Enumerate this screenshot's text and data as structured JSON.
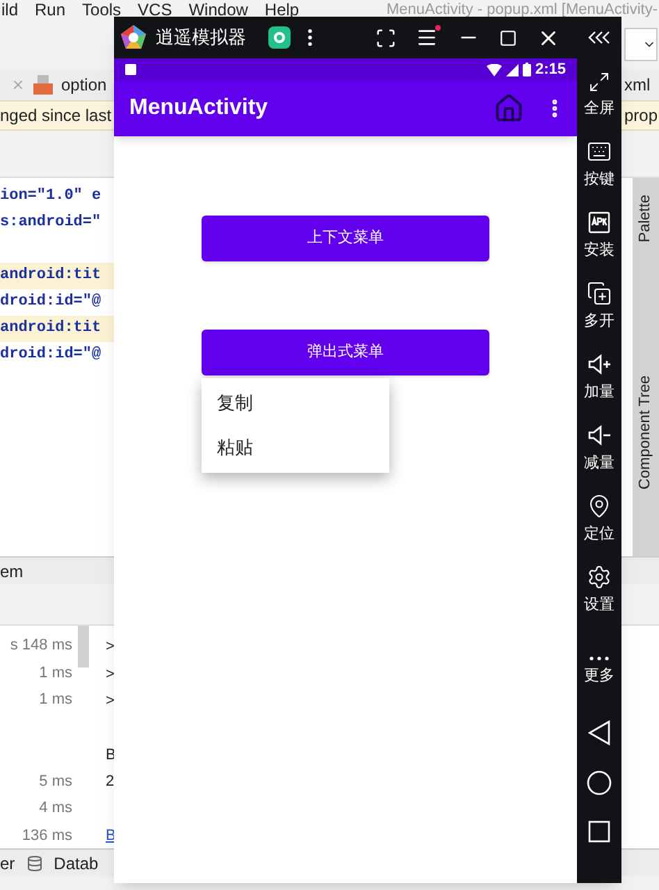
{
  "ide": {
    "menu_bar": [
      "ild",
      "Run",
      "Tools",
      "VCS",
      "Window",
      "Help"
    ],
    "window_title": "MenuActivity - popup.xml [MenuActivity-",
    "editor_tabs": [
      "option",
      "xml"
    ],
    "banner": [
      "nged since last",
      "prop"
    ],
    "code_lines": [
      {
        "text": "ion=\"1.0\" e",
        "highlighted": false
      },
      {
        "text": "s:android=\"",
        "highlighted": false
      },
      {
        "text": "android:tit",
        "highlighted": true
      },
      {
        "text": "droid:id=\"@",
        "highlighted": false
      },
      {
        "text": "android:tit",
        "highlighted": true
      },
      {
        "text": "droid:id=\"@",
        "highlighted": false
      }
    ],
    "side_tabs": [
      "Palette",
      "Component Tree"
    ],
    "panel_title": "em",
    "timing_groups": [
      [
        "s 148 ms",
        "1 ms",
        "1 ms"
      ],
      [
        "5 ms",
        "4 ms",
        "136 ms"
      ]
    ],
    "console_groups": [
      [
        {
          "text": ">",
          "kind": "plain"
        },
        {
          "text": ">",
          "kind": "plain"
        },
        {
          "text": ">",
          "kind": "plain"
        }
      ],
      [
        {
          "text": "B",
          "kind": "plain"
        },
        {
          "text": "2",
          "kind": "plain"
        }
      ],
      [
        {
          "text": "B",
          "kind": "link"
        }
      ]
    ],
    "status_bar": [
      "er",
      "Datab"
    ]
  },
  "emulator": {
    "title": "逍遥模拟器",
    "tools": [
      {
        "label": "全屏",
        "kind": "fullscreen"
      },
      {
        "label": "按键",
        "kind": "keyboard"
      },
      {
        "label": "安装",
        "kind": "apk"
      },
      {
        "label": "多开",
        "kind": "multi"
      },
      {
        "label": "加量",
        "kind": "volume_up"
      },
      {
        "label": "减量",
        "kind": "volume_down"
      },
      {
        "label": "定位",
        "kind": "location"
      },
      {
        "label": "设置",
        "kind": "settings"
      },
      {
        "label": "更多",
        "kind": "more"
      }
    ]
  },
  "phone": {
    "time": "2:15",
    "app_title": "MenuActivity",
    "buttons": [
      "上下文菜单",
      "弹出式菜单"
    ],
    "popup_menu": [
      "复制",
      "粘贴"
    ]
  }
}
